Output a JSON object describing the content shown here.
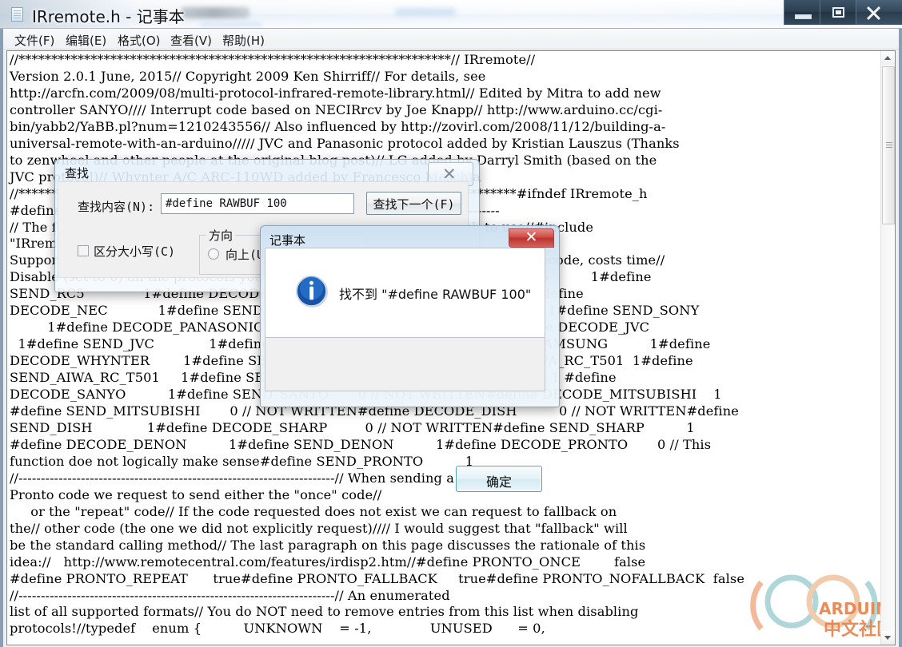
{
  "window": {
    "title": "IRremote.h - 记事本",
    "icon": "notepad-icon",
    "controls": {
      "minimize": "最小化",
      "restore": "向下还原",
      "close": "关闭"
    }
  },
  "menu": {
    "items": [
      {
        "label": "文件(F)"
      },
      {
        "label": "编辑(E)"
      },
      {
        "label": "格式(O)"
      },
      {
        "label": "查看(V)"
      },
      {
        "label": "帮助(H)"
      }
    ]
  },
  "editor": {
    "content": "//******************************************************************// IRremote//\nVersion 2.0.1 June, 2015// Copyright 2009 Ken Shirriff// For details, see\nhttp://arcfn.com/2009/08/multi-protocol-infrared-remote-library.html// Edited by Mitra to add new\ncontroller SANYO//// Interrupt code based on NECIRrcv by Joe Knapp// http://www.arduino.cc/cgi-\nbin/yabb2/YaBB.pl?num=1210243556// Also influenced by http://zovirl.com/2008/11/12/building-a-\nuniversal-remote-with-an-arduino///// JVC and Panasonic protocol added by Kristian Lauszus (Thanks\nto zenwheel and other people at the original blog post)// LG added by Darryl Smith (based on the\nJVC protocol)// Whynter A/C ARC-110WD added by Francesco Meschia\n//****************************************************************************#ifndef IRremote_h\n#define IRremote_h//------------------------------------------------------------------------------\n// The following define causes the library to use the protocols you wish to use//#include\n\"IRremoteInt.h\"//------------------------------------------------------------------------//\nSupported IR protocols// Each protocol you include costs memory and, during decode, costs time//\nDisable (set to 0) all the protocols you do not need/want!//#define DECODE_RC5          1#define\nSEND_RC5              1#define DECODE_RC6           1#define SEND_RC6        1#define\nDECODE_NEC            1#define SEND_NEC             1#define DECODE_SONY     1#define SEND_SONY\n         1#define DECODE_PANASONIC     1#define SEND_PANASONIC   1#define DECODE_JVC\n  1#define SEND_JVC             1#define DECODE_SAMSUNG  1#define SEND_SAMSUNG          1#define\nDECODE_WHYNTER        1#define SEND_WHYNTER     1#define DECODE_AIWA_RC_T501  1#define\nSEND_AIWA_RC_T501     1#define SEND_LG              1#define SEND_LG            1 #define\nDECODE_SANYO          1#define SEND_SANYO       0 // NOT WRITTEN#define DECODE_MITSUBISHI    1\n#define SEND_MITSUBISHI       0 // NOT WRITTEN#define DECODE_DISH          0 // NOT WRITTEN#define\nSEND_DISH             1#define DECODE_SHARP         0 // NOT WRITTEN#define SEND_SHARP          1\n#define DECODE_DENON          1#define SEND_DENON          1#define DECODE_PRONTO       0 // This\nfunction doe not logically make sense#define SEND_PRONTO          1\n//-----------------------------------------------------------------------// When sending a\nPronto code we request to send either the \"once\" code//\n     or the \"repeat\" code// If the code requested does not exist we can request to fallback on\nthe// other code (the one we did not explicitly request)//// I would suggest that \"fallback\" will\nbe the standard calling method// The last paragraph on this page discusses the rationale of this\nidea://   http://www.remotecentral.com/features/irdisp2.htm//#define PRONTO_ONCE        false\n#define PRONTO_REPEAT      true#define PRONTO_FALLBACK     true#define PRONTO_NOFALLBACK  false\n//-----------------------------------------------------------------------// An enumerated\nlist of all supported formats// You do NOT need to remove entries from this list when disabling\nprotocols!//typedef    enum {          UNKNOWN    = -1,              UNUSED      = 0,"
  },
  "scrollbar": {
    "up_arrow": "scroll-up-arrow",
    "down_arrow": "scroll-down-arrow"
  },
  "watermark": {
    "brand": "ARDUINO",
    "subtitle": "中文社区"
  },
  "find_dialog": {
    "title": "查找",
    "close_glyph": "✕",
    "find_what_label": "查找内容(N):",
    "find_what_value": "#define RAWBUF 100",
    "find_next_button": "查找下一个(F)",
    "match_case_label": "区分大小写(C)",
    "direction_group": "方向",
    "direction_up": "向上(U)"
  },
  "message_box": {
    "title": "记事本",
    "icon": "information-icon",
    "message": "找不到 \"#define RAWBUF 100\"",
    "ok_button": "确定",
    "close_glyph": "✕"
  },
  "colors": {
    "accent_blue": "#3f7fbf",
    "close_red": "#cf4a44",
    "watermark_orange": "#e8834a",
    "watermark_teal": "#6fb7bd"
  }
}
